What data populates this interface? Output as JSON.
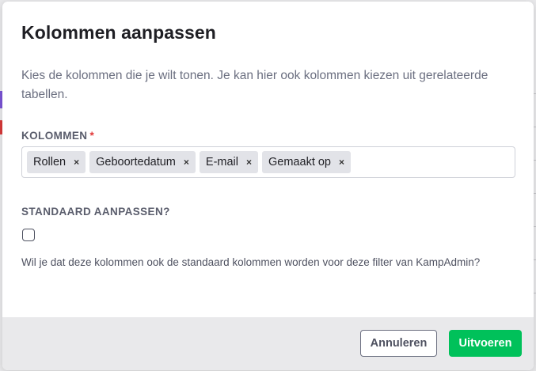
{
  "modal": {
    "title": "Kolommen aanpassen",
    "description": "Kies de kolommen die je wilt tonen. Je kan hier ook kolommen kiezen uit gerelateerde tabellen."
  },
  "columns_field": {
    "label": "KOLOMMEN",
    "required_marker": "*",
    "tags": [
      "Rollen",
      "Geboortedatum",
      "E-mail",
      "Gemaakt op"
    ],
    "remove_glyph": "×"
  },
  "default_field": {
    "label": "STANDAARD AANPASSEN?",
    "checked": false,
    "help_text": "Wil je dat deze kolommen ook de standaard kolommen worden voor deze filter van KampAdmin?"
  },
  "footer": {
    "cancel_label": "Annuleren",
    "apply_label": "Uitvoeren"
  },
  "colors": {
    "accent_green": "#00c15a",
    "required_red": "#e23a3a",
    "footer_bg": "#e9e9eb"
  }
}
